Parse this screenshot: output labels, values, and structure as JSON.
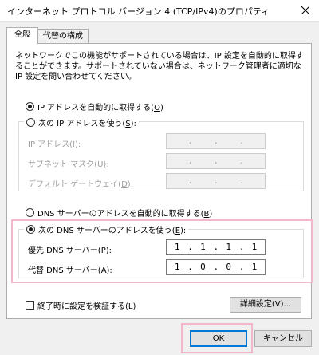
{
  "window": {
    "title": "インターネット プロトコル バージョン 4 (TCP/IPv4)のプロパティ",
    "close_icon": "close-icon"
  },
  "tabs": [
    {
      "label": "全般",
      "active": true
    },
    {
      "label": "代替の構成",
      "active": false
    }
  ],
  "description": "ネットワークでこの機能がサポートされている場合は、IP 設定を自動的に取得することができます。サポートされていない場合は、ネットワーク管理者に適切な IP 設定を問い合わせてください。",
  "ip_section": {
    "auto_label_pre": "IP アドレスを自動的に取得する(",
    "auto_key": "O",
    "auto_label_post": ")",
    "auto_checked": true,
    "manual_label_pre": "次の IP アドレスを使う(",
    "manual_key": "S",
    "manual_label_post": "):",
    "manual_checked": false,
    "fields": [
      {
        "label_pre": "IP アドレス(",
        "key": "I",
        "label_post": "):",
        "segments": [
          "",
          "",
          "",
          ""
        ]
      },
      {
        "label_pre": "サブネット マスク(",
        "key": "U",
        "label_post": "):",
        "segments": [
          "",
          "",
          "",
          ""
        ]
      },
      {
        "label_pre": "デフォルト ゲートウェイ(",
        "key": "D",
        "label_post": "):",
        "segments": [
          "",
          "",
          "",
          ""
        ]
      }
    ]
  },
  "dns_section": {
    "auto_label_pre": "DNS サーバーのアドレスを自動的に取得する(",
    "auto_key": "B",
    "auto_label_post": ")",
    "auto_checked": false,
    "manual_label_pre": "次の DNS サーバーのアドレスを使う(",
    "manual_key": "E",
    "manual_label_post": "):",
    "manual_checked": true,
    "preferred": {
      "label_pre": "優先 DNS サーバー(",
      "key": "P",
      "label_post": "):",
      "segments": [
        "1",
        "1",
        "1",
        "1"
      ]
    },
    "alternate": {
      "label_pre": "代替 DNS サーバー(",
      "key": "A",
      "label_post": "):",
      "segments": [
        "1",
        "0",
        "0",
        "1"
      ]
    }
  },
  "validate": {
    "label_pre": "終了時に設定を検証する(",
    "key": "L",
    "label_post": ")",
    "checked": false
  },
  "buttons": {
    "advanced": "詳細設定(V)...",
    "ok": "OK",
    "cancel": "キャンセル"
  },
  "colors": {
    "highlight": "#f4b6cc",
    "focus": "#0078d7"
  }
}
